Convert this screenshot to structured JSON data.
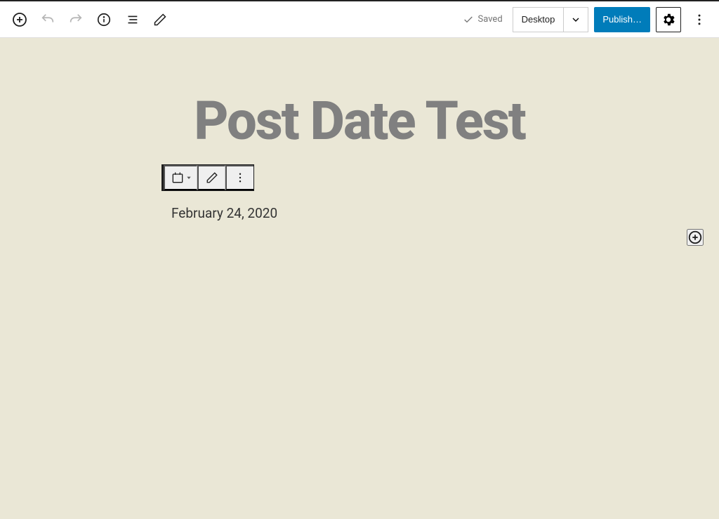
{
  "toolbar": {
    "saved_label": "Saved",
    "preview_mode": "Desktop",
    "publish_label": "Publish…"
  },
  "content": {
    "title": "Post Date Test",
    "date_text": "February 24, 2020"
  }
}
